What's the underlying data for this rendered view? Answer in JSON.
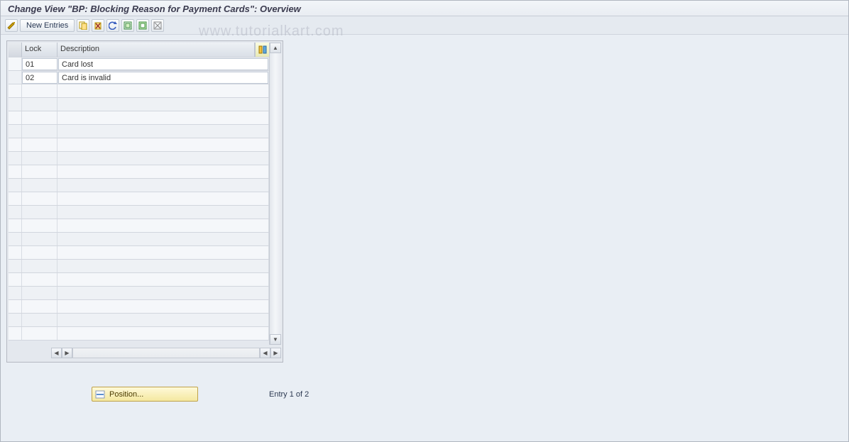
{
  "title": "Change View \"BP: Blocking Reason for Payment Cards\": Overview",
  "watermark": "www.tutorialkart.com",
  "toolbar": {
    "new_entries_label": "New Entries"
  },
  "table": {
    "headers": {
      "lock": "Lock",
      "description": "Description"
    },
    "rows": [
      {
        "lock": "01",
        "description": "Card lost"
      },
      {
        "lock": "02",
        "description": "Card is invalid"
      }
    ],
    "empty_row_count": 19
  },
  "footer": {
    "position_label": "Position...",
    "entry_text": "Entry 1 of 2"
  }
}
